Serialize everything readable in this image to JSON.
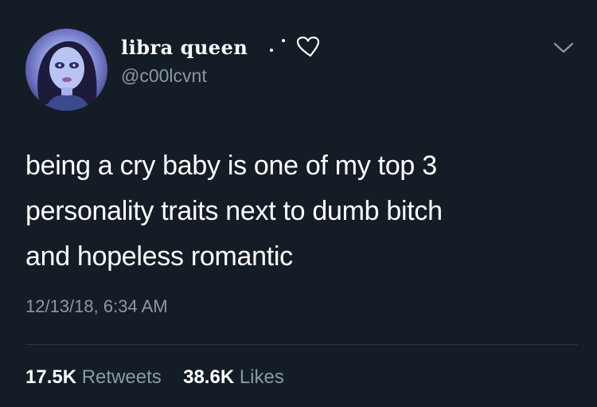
{
  "author": {
    "display_name": "libra queen",
    "handle": "@c00lcvnt",
    "avatar": "bratz-doll-avatar"
  },
  "icons": {
    "heart": "heart-outline-icon",
    "menu": "chevron-down-icon"
  },
  "tweet": {
    "lines": [
      "being a cry baby is one of my top 3",
      "personality traits next to dumb bitch",
      "and hopeless romantic"
    ],
    "timestamp": "12/13/18, 6:34 AM"
  },
  "stats": {
    "retweets_count": "17.5K",
    "retweets_label": "Retweets",
    "likes_count": "38.6K",
    "likes_label": "Likes"
  },
  "colors": {
    "background": "#141d26",
    "text": "#ffffff",
    "secondary": "#8b98a5"
  }
}
